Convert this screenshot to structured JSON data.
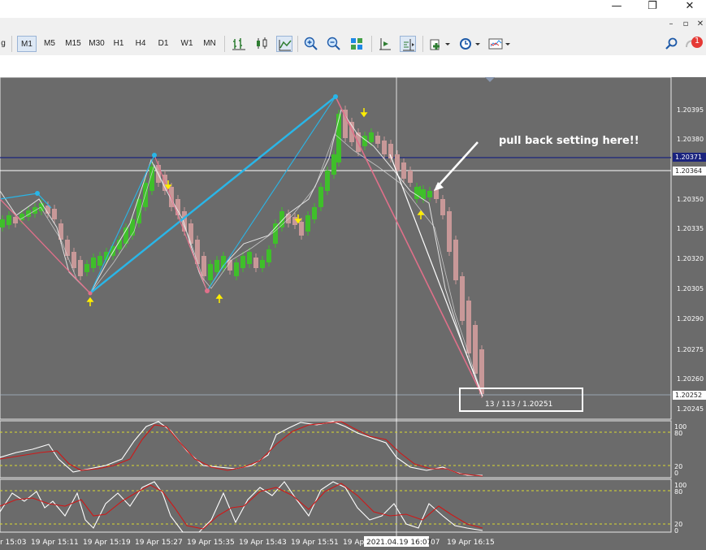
{
  "window": {
    "minimize": "—",
    "restore": "❐",
    "close": "✕"
  },
  "mdi": {
    "minimize": "–",
    "restore": "▫",
    "close": "✕"
  },
  "toolbar": {
    "left_fragment": "g",
    "timeframes": [
      "M1",
      "M5",
      "M15",
      "M30",
      "H1",
      "H4",
      "D1",
      "W1",
      "MN"
    ],
    "active_timeframe": "M1",
    "notification_count": "1"
  },
  "price_axis": {
    "ticks": [
      "1.20395",
      "1.20380",
      "1.20365",
      "1.20350",
      "1.20335",
      "1.20320",
      "1.20305",
      "1.20290",
      "1.20275",
      "1.20260",
      "1.20245"
    ],
    "line_blue": "1.20371",
    "line_white": "1.20364",
    "line_current": "1.20252"
  },
  "osc_axis": {
    "levels": [
      "100",
      "80",
      "20",
      "0"
    ]
  },
  "time_axis": {
    "labels": [
      "r 15:03",
      "19 Apr 15:11",
      "19 Apr 15:19",
      "19 Apr 15:27",
      "19 Apr 15:35",
      "19 Apr 15:43",
      "19 Apr 15:51",
      "19 Ap",
      "07",
      "19 Apr 16:15"
    ],
    "crosshair": "2021.04.19 16:07"
  },
  "annotation": "pull back setting here!!",
  "info_box": "13 / 113 / 1.20251",
  "colors": {
    "chart_bg": "#6b6b6b",
    "bull": "#3fbf2a",
    "bear": "#c89898",
    "zigzag_blue": "#29b6e8",
    "zigzag_pink": "#e0708a",
    "signal_arrow": "#ffee00",
    "stoch_main": "#ffffff",
    "stoch_signal": "#d01818",
    "level_line": "#d8d830",
    "blue_line": "#1a237e"
  }
}
